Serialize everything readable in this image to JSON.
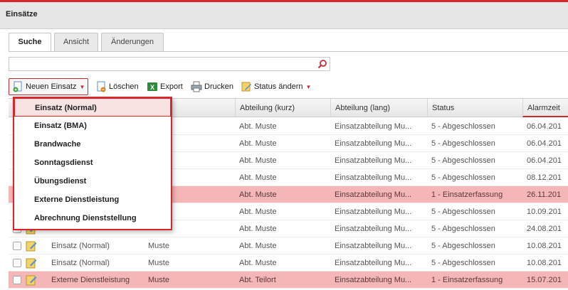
{
  "panel": {
    "title": "Einsätze"
  },
  "tabs": [
    {
      "label": "Suche",
      "active": true
    },
    {
      "label": "Ansicht",
      "active": false
    },
    {
      "label": "Änderungen",
      "active": false
    }
  ],
  "search": {
    "value": "",
    "placeholder": "",
    "button_icon": "search-icon"
  },
  "toolbar": {
    "new_label": "Neuen Einsatz",
    "delete_label": "Löschen",
    "export_label": "Export",
    "print_label": "Drucken",
    "status_label": "Status ändern"
  },
  "grid": {
    "columns": [
      "",
      "",
      "Abteilung (kurz)",
      "Abteilung (lang)",
      "Status",
      "Alarmzeit"
    ],
    "rows": [
      {
        "type": "",
        "org": "",
        "abt_kurz": "Abt. Muste",
        "abt_lang": "Einsatzabteilung Mu...",
        "status": "5 - Abgeschlossen",
        "alarm": "06.04.201",
        "highlight": false
      },
      {
        "type": "",
        "org": "",
        "abt_kurz": "Abt. Muste",
        "abt_lang": "Einsatzabteilung Mu...",
        "status": "5 - Abgeschlossen",
        "alarm": "06.04.201",
        "highlight": false
      },
      {
        "type": "",
        "org": "",
        "abt_kurz": "Abt. Muste",
        "abt_lang": "Einsatzabteilung Mu...",
        "status": "5 - Abgeschlossen",
        "alarm": "06.04.201",
        "highlight": false
      },
      {
        "type": "",
        "org": "",
        "abt_kurz": "Abt. Muste",
        "abt_lang": "Einsatzabteilung Mu...",
        "status": "5 - Abgeschlossen",
        "alarm": "08.12.201",
        "highlight": false
      },
      {
        "type": "",
        "org": "",
        "abt_kurz": "Abt. Muste",
        "abt_lang": "Einsatzabteilung Mu...",
        "status": "1 - Einsatzerfassung",
        "alarm": "26.11.201",
        "highlight": true
      },
      {
        "type": "",
        "org": "",
        "abt_kurz": "Abt. Muste",
        "abt_lang": "Einsatzabteilung Mu...",
        "status": "5 - Abgeschlossen",
        "alarm": "10.09.201",
        "highlight": false
      },
      {
        "type": "",
        "org": "",
        "abt_kurz": "Abt. Muste",
        "abt_lang": "Einsatzabteilung Mu...",
        "status": "5 - Abgeschlossen",
        "alarm": "24.08.201",
        "highlight": false
      },
      {
        "type": "Einsatz (Normal)",
        "org": "Muste",
        "abt_kurz": "Abt. Muste",
        "abt_lang": "Einsatzabteilung Mu...",
        "status": "5 - Abgeschlossen",
        "alarm": "10.08.201",
        "highlight": false
      },
      {
        "type": "Einsatz (Normal)",
        "org": "Muste",
        "abt_kurz": "Abt. Muste",
        "abt_lang": "Einsatzabteilung Mu...",
        "status": "5 - Abgeschlossen",
        "alarm": "10.08.201",
        "highlight": false
      },
      {
        "type": "Externe Dienstleistung",
        "org": "Muste",
        "abt_kurz": "Abt. Teilort",
        "abt_lang": "Einsatzabteilung Mu...",
        "status": "1 - Einsatzerfassung",
        "alarm": "15.07.201",
        "highlight": true
      }
    ]
  },
  "dropdown": {
    "items": [
      "Einsatz (Normal)",
      "Einsatz (BMA)",
      "Brandwache",
      "Sonntagsdienst",
      "Übungsdienst",
      "Externe Dienstleistung",
      "Abrechnung Dienststellung"
    ]
  },
  "colors": {
    "accent": "#d7272d",
    "highlight_row": "#f5b6b8"
  }
}
